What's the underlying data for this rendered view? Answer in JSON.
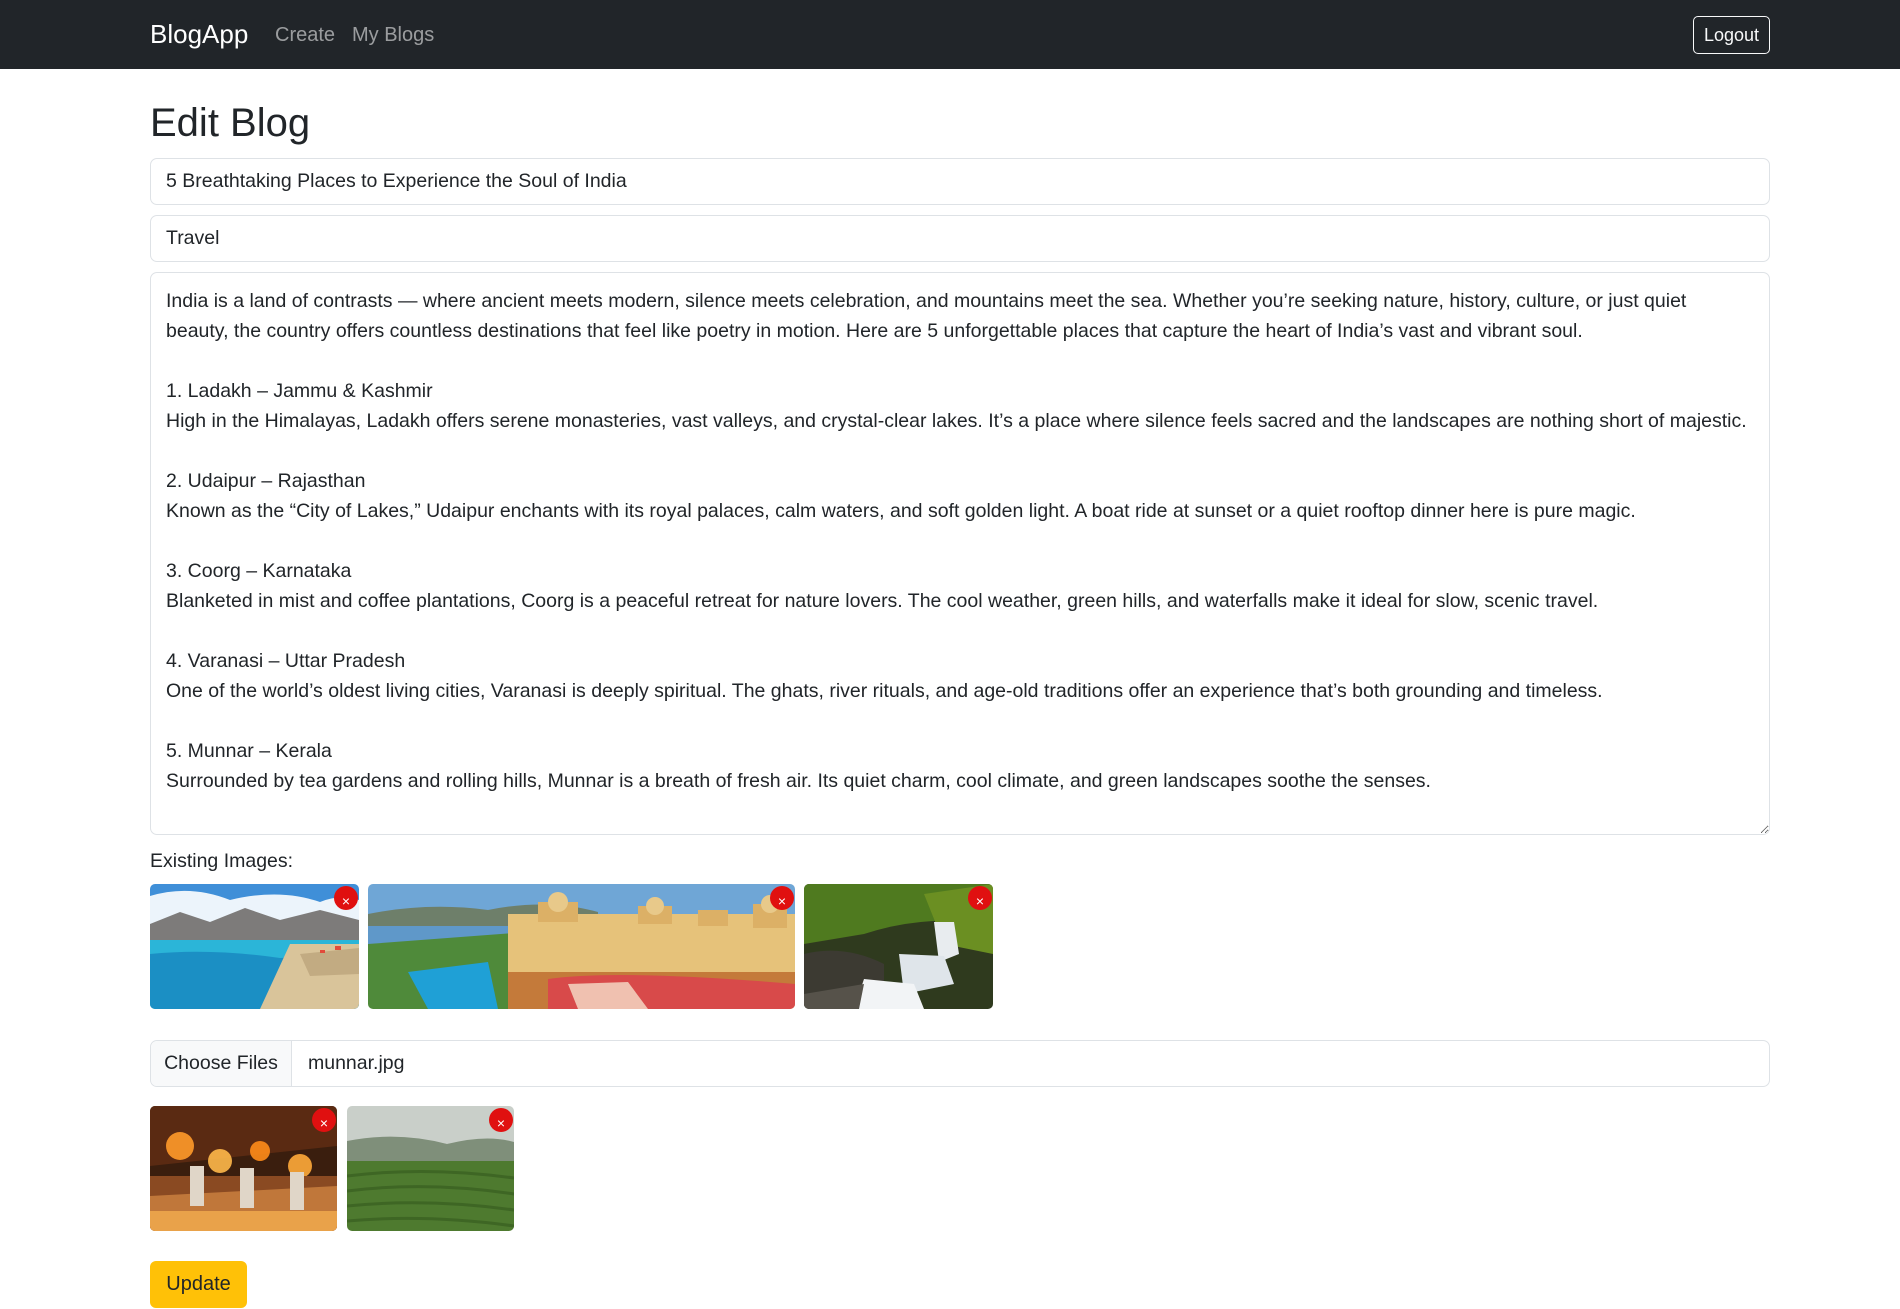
{
  "navbar": {
    "brand": "BlogApp",
    "links": [
      "Create",
      "My Blogs"
    ],
    "logout_label": "Logout"
  },
  "page": {
    "title": "Edit Blog"
  },
  "form": {
    "title_value": "5 Breathtaking Places to Experience the Soul of India",
    "category_value": "Travel",
    "content_value": "India is a land of contrasts — where ancient meets modern, silence meets celebration, and mountains meet the sea. Whether you’re seeking nature, history, culture, or just quiet beauty, the country offers countless destinations that feel like poetry in motion. Here are 5 unforgettable places that capture the heart of India’s vast and vibrant soul.\n\n1. Ladakh – Jammu & Kashmir\nHigh in the Himalayas, Ladakh offers serene monasteries, vast valleys, and crystal-clear lakes. It’s a place where silence feels sacred and the landscapes are nothing short of majestic.\n\n2. Udaipur – Rajasthan\nKnown as the “City of Lakes,” Udaipur enchants with its royal palaces, calm waters, and soft golden light. A boat ride at sunset or a quiet rooftop dinner here is pure magic.\n\n3. Coorg – Karnataka\nBlanketed in mist and coffee plantations, Coorg is a peaceful retreat for nature lovers. The cool weather, green hills, and waterfalls make it ideal for slow, scenic travel.\n\n4. Varanasi – Uttar Pradesh\nOne of the world’s oldest living cities, Varanasi is deeply spiritual. The ghats, river rituals, and age-old traditions offer an experience that’s both grounding and timeless.\n\n5. Munnar – Kerala\nSurrounded by tea gardens and rolling hills, Munnar is a breath of fresh air. Its quiet charm, cool climate, and green landscapes soothe the senses.",
    "existing_images_label": "Existing Images:",
    "existing_images": [
      {
        "subject": "ladakh lake photo"
      },
      {
        "subject": "udaipur palace photo"
      },
      {
        "subject": "coorg waterfall photo"
      }
    ],
    "file_input": {
      "button_label": "Choose Files",
      "file_name": "munnar.jpg"
    },
    "new_images": [
      {
        "subject": "varanasi ghat photo"
      },
      {
        "subject": "munnar tea garden photo"
      }
    ],
    "remove_icon": "×",
    "update_label": "Update"
  },
  "colors": {
    "navbar_bg": "#212529",
    "remove_red": "#e01010",
    "update_yellow": "#ffc107"
  }
}
